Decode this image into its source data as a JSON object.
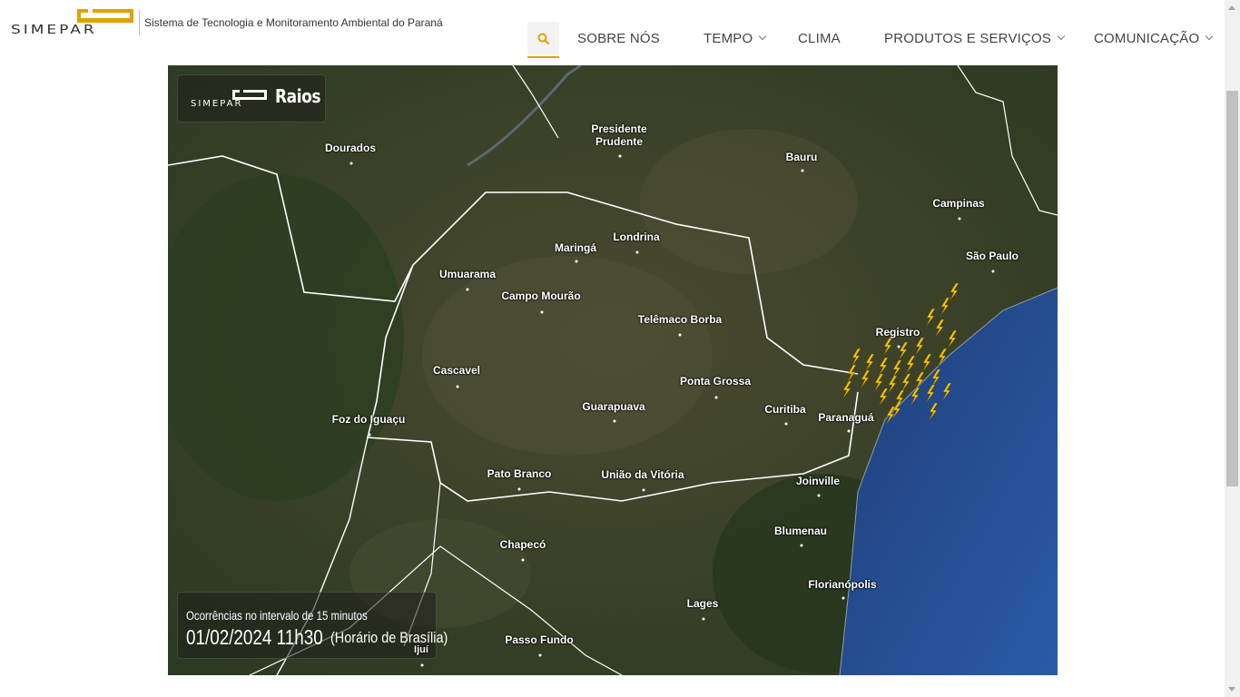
{
  "header": {
    "logo_text": "SIMEPAR",
    "tagline": "Sistema de Tecnologia e Monitoramento Ambiental do Paraná",
    "nav": [
      {
        "label": "SOBRE NÓS",
        "dropdown": false
      },
      {
        "label": "TEMPO",
        "dropdown": true
      },
      {
        "label": "CLIMA",
        "dropdown": false
      },
      {
        "label": "PRODUTOS E SERVIÇOS",
        "dropdown": true
      },
      {
        "label": "COMUNICAÇÃO",
        "dropdown": true
      }
    ],
    "search_icon": "search-icon",
    "accent_color": "#e5a000"
  },
  "map": {
    "badge_logo": "SIMEPAR",
    "title": "Raios",
    "interval_text": "Ocorrências no intervalo de 15 minutos",
    "datetime": "01/02/2024 11h30",
    "timezone": "(Horário de Brasília)",
    "lightning_color": "#f5c400",
    "cities": [
      "Dourados",
      "Presidente Prudente",
      "Bauru",
      "Campinas",
      "São Paulo",
      "Maringá",
      "Londrina",
      "Umuarama",
      "Campo Mourão",
      "Telêmaco Borba",
      "Registro",
      "Cascavel",
      "Ponta Grossa",
      "Guarapuava",
      "Curitiba",
      "Paranaguá",
      "Foz do Iguaçu",
      "Pato Branco",
      "União da Vitória",
      "Joinville",
      "Chapecó",
      "Blumenau",
      "Florianópolis",
      "Lages",
      "Passo Fundo",
      "Ijuí"
    ]
  }
}
